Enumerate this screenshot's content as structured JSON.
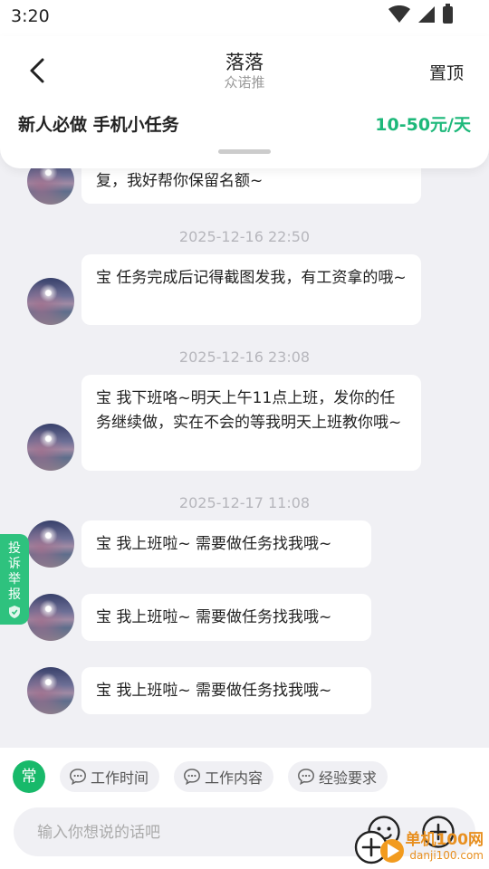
{
  "status_bar": {
    "time": "3:20"
  },
  "header": {
    "title": "落落",
    "subtitle": "众诺推",
    "pin_label": "置顶",
    "task_title": "新人必做 手机小任务",
    "task_pay": "10-50元/天"
  },
  "messages": [
    {
      "text": "复，我好帮你保留名额~"
    },
    {
      "time": "2025-12-16 22:50"
    },
    {
      "text": "宝 任务完成后记得截图发我，有工资拿的哦~"
    },
    {
      "time": "2025-12-16 23:08"
    },
    {
      "text": "宝 我下班咯~明天上午11点上班，发你的任务继续做，实在不会的等我明天上班教你哦~"
    },
    {
      "time": "2025-12-17 11:08"
    },
    {
      "text": "宝 我上班啦~ 需要做任务找我哦~"
    },
    {
      "text": "宝 我上班啦~ 需要做任务找我哦~"
    },
    {
      "text": "宝 我上班啦~ 需要做任务找我哦~"
    }
  ],
  "report_tab": {
    "label": "投诉举报"
  },
  "quick_replies": {
    "common_label": "常",
    "items": [
      "工作时间",
      "工作内容",
      "经验要求"
    ]
  },
  "input": {
    "placeholder": "输入你想说的话吧"
  },
  "watermark": {
    "name": "单机100网",
    "url": "danji100.com"
  },
  "colors": {
    "accent": "#1db87a",
    "report_tab": "#2ec27e",
    "chat_bg": "#f0f0f4"
  }
}
